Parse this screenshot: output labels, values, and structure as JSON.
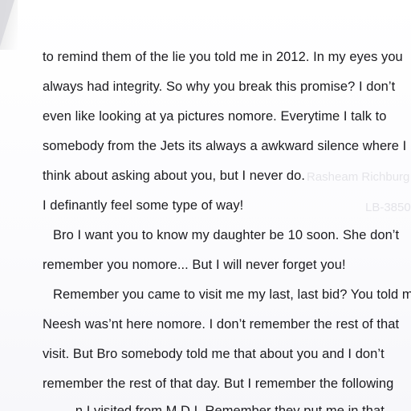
{
  "document": {
    "lines": [
      {
        "text": "to remind them of the lie you told me in 2012. In my eyes you"
      },
      {
        "text": "always had integrity. So why you break this promise? I don’t"
      },
      {
        "text": "even like looking at ya pictures nomore. Everytime I talk to"
      },
      {
        "text": "somebody from the Jets its always a awkward silence where I"
      },
      {
        "text": "think about asking about you, but I never do."
      },
      {
        "text": "I definantly feel some type of way!"
      },
      {
        "text": "Bro I want you to know my daughter be 10 soon. She don’t"
      },
      {
        "text": "remember you nomore... But I will never forget you!"
      },
      {
        "text": "Remember you came to visit me my last, last bid? You told m"
      },
      {
        "text": "Neesh was’nt here nomore. I don’t remember the rest of that"
      },
      {
        "text": "visit. But Bro somebody told me that about you and I don’t"
      },
      {
        "text": "remember the rest of that day. But I remember the following"
      },
      {
        "text": "...n I visited from M.D.I. Remember they put me in that"
      }
    ],
    "bleed_through": {
      "name": "Rasheam Richburg",
      "code": "LB-3850"
    }
  }
}
